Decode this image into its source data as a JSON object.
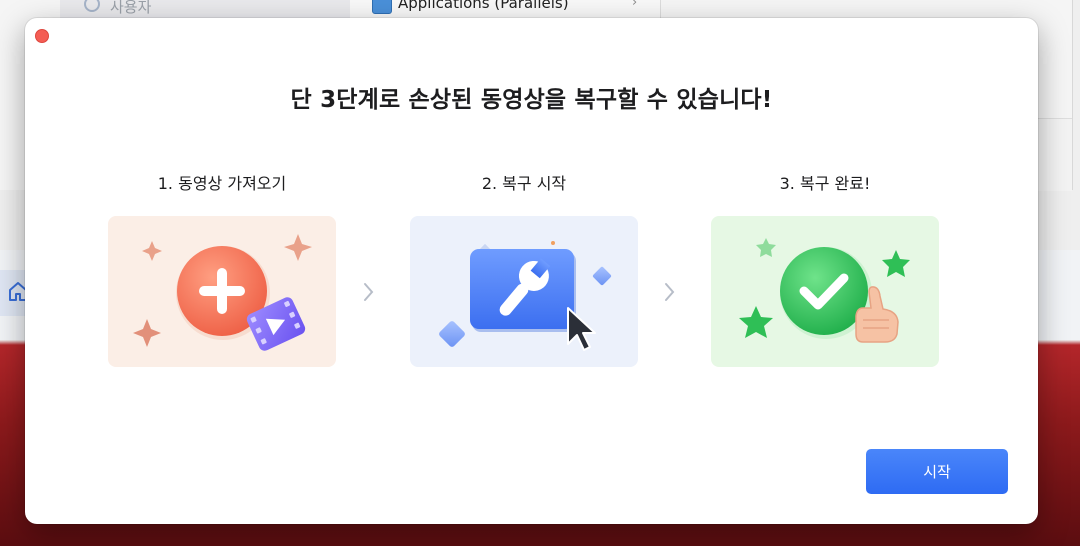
{
  "background": {
    "sidebar_user_label": "사용자",
    "middle_item_label": "Applications (Parallels)"
  },
  "dialog": {
    "title": "단 3단계로 손상된 동영상을 복구할 수 있습니다!",
    "steps": [
      {
        "label": "1. 동영상 가져오기",
        "icon": "add-video-icon"
      },
      {
        "label": "2. 복구 시작",
        "icon": "repair-wrench-icon"
      },
      {
        "label": "3. 복구 완료!",
        "icon": "check-thumbs-up-icon"
      }
    ],
    "start_button_label": "시작"
  },
  "colors": {
    "primary_button": "#3b7cf7",
    "close_button": "#f45d54",
    "card_1_bg": "#fbeee6",
    "card_2_bg": "#ecf1fb",
    "card_3_bg": "#e6f8e4"
  }
}
